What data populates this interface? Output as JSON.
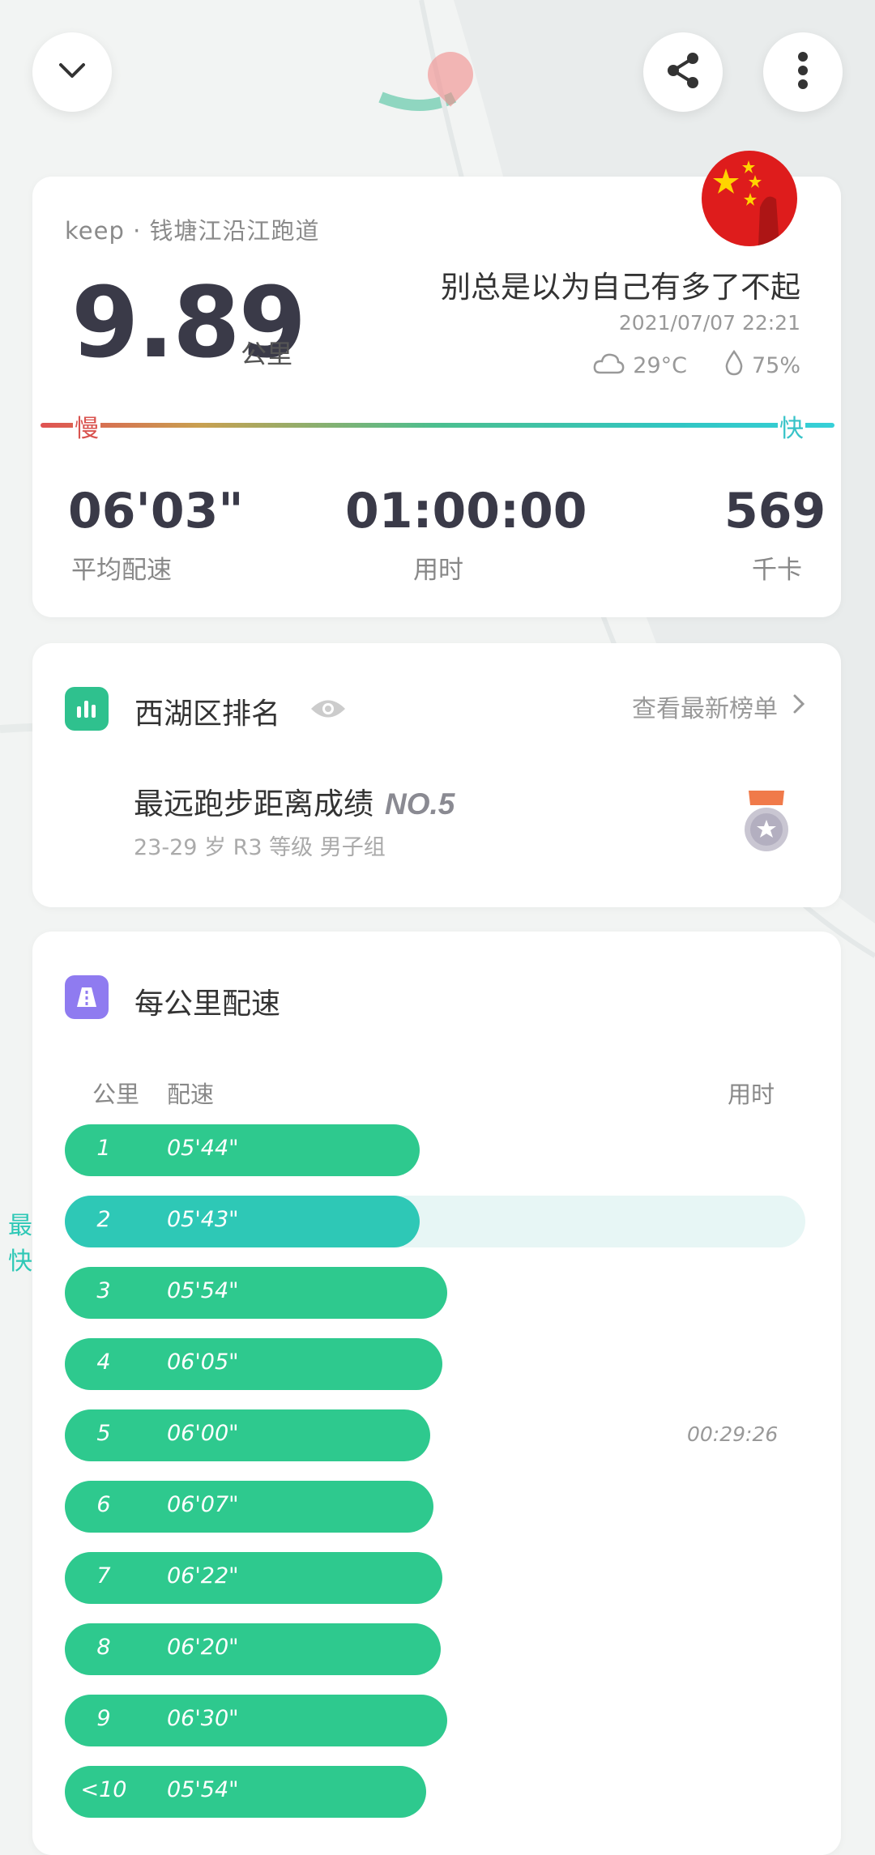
{
  "header": {
    "collapse_icon": "chevron-down-icon",
    "share_icon": "share-icon",
    "more_icon": "more-vertical-icon"
  },
  "summary": {
    "source": "keep · 钱塘江沿江跑道",
    "distance": "9.89",
    "distance_unit": "公里",
    "motto": "别总是以为自己有多了不起",
    "datetime": "2021/07/07 22:21",
    "temperature": "29°C",
    "humidity": "75%",
    "pace_slow_label": "慢",
    "pace_fast_label": "快",
    "stats": {
      "avg_pace": "06'03\"",
      "avg_pace_label": "平均配速",
      "duration": "01:00:00",
      "duration_label": "用时",
      "calories": "569",
      "calories_label": "千卡"
    }
  },
  "ranking": {
    "title": "西湖区排名",
    "link": "查看最新榜单",
    "achievement": "最远跑步距离成绩",
    "rank": "NO.5",
    "group": "23-29 岁 R3 等级 男子组"
  },
  "pace_section": {
    "title": "每公里配速",
    "col_km": "公里",
    "col_pace": "配速",
    "col_time": "用时",
    "fastest_tag": "最快",
    "rows": [
      {
        "km": "1",
        "pace": "05'44\"",
        "fill": 0.479,
        "fastest": false,
        "time": ""
      },
      {
        "km": "2",
        "pace": "05'43\"",
        "fill": 0.479,
        "fastest": true,
        "time": ""
      },
      {
        "km": "3",
        "pace": "05'54\"",
        "fill": 0.516,
        "fastest": false,
        "time": ""
      },
      {
        "km": "4",
        "pace": "06'05\"",
        "fill": 0.51,
        "fastest": false,
        "time": ""
      },
      {
        "km": "5",
        "pace": "06'00\"",
        "fill": 0.493,
        "fastest": false,
        "time": "00:29:26"
      },
      {
        "km": "6",
        "pace": "06'07\"",
        "fill": 0.498,
        "fastest": false,
        "time": ""
      },
      {
        "km": "7",
        "pace": "06'22\"",
        "fill": 0.51,
        "fastest": false,
        "time": ""
      },
      {
        "km": "8",
        "pace": "06'20\"",
        "fill": 0.508,
        "fastest": false,
        "time": ""
      },
      {
        "km": "9",
        "pace": "06'30\"",
        "fill": 0.516,
        "fastest": false,
        "time": ""
      },
      {
        "km": "<10",
        "pace": "05'54\"",
        "fill": 0.488,
        "fastest": false,
        "time": ""
      }
    ]
  },
  "colors": {
    "bar": "#2ec98e",
    "bar_fastest": "#2ec8b6",
    "track": "#e7f6f5"
  }
}
